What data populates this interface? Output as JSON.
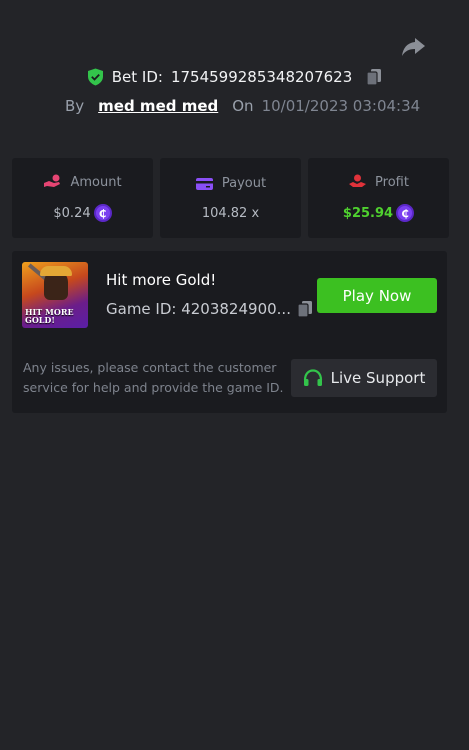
{
  "bet": {
    "label": "Bet ID:",
    "id": "1754599285348207623",
    "by_label": "By",
    "user": "med med med",
    "on_label": "On",
    "datetime": "10/01/2023 03:04:34"
  },
  "stats": {
    "amount": {
      "label": "Amount",
      "value": "$0.24",
      "icon": "hand-coin-icon"
    },
    "payout": {
      "label": "Payout",
      "value": "104.82 x",
      "icon": "card-icon"
    },
    "profit": {
      "label": "Profit",
      "value": "$25.94",
      "icon": "profit-hand-icon"
    },
    "coin_symbol": "₵"
  },
  "game": {
    "name": "Hit more Gold!",
    "id_text": "Game ID: 4203824900...",
    "thumb_title": "HIT MORE GOLD!",
    "play_label": "Play Now"
  },
  "support": {
    "text": "Any issues, please contact the customer service for help and provide the game ID.",
    "button_label": "Live Support"
  },
  "colors": {
    "background": "#232428",
    "card": "#1a1b1f",
    "accent_green": "#3cc021",
    "profit_green": "#4fd12f",
    "coin_purple": "#7a3ff0"
  }
}
